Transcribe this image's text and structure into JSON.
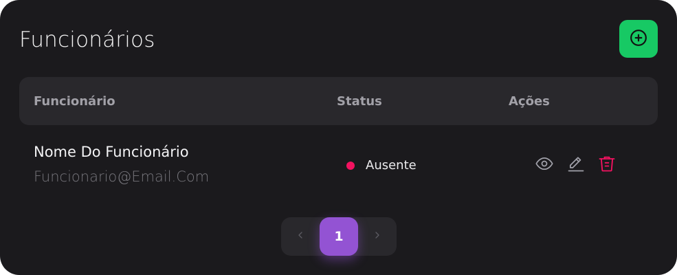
{
  "page": {
    "title": "Funcionários"
  },
  "toolbar": {
    "add_icon": "plus-circle-icon"
  },
  "table": {
    "columns": [
      "Funcionário",
      "Status",
      "Ações"
    ],
    "rows": [
      {
        "name": "Nome Do Funcionário",
        "email": "Funcionario@Email.Com",
        "status": "Ausente",
        "status_color": "#f31260",
        "actions": [
          "eye-icon",
          "pencil-icon",
          "trash-icon"
        ]
      }
    ]
  },
  "pagination": {
    "current_page": "1",
    "prev_icon": "chevron-left-icon",
    "next_icon": "chevron-right-icon"
  },
  "colors": {
    "background": "#1b1a1d",
    "surface": "#29282c",
    "success": "#17c964",
    "danger": "#f31260",
    "accent": "#9353d3"
  }
}
